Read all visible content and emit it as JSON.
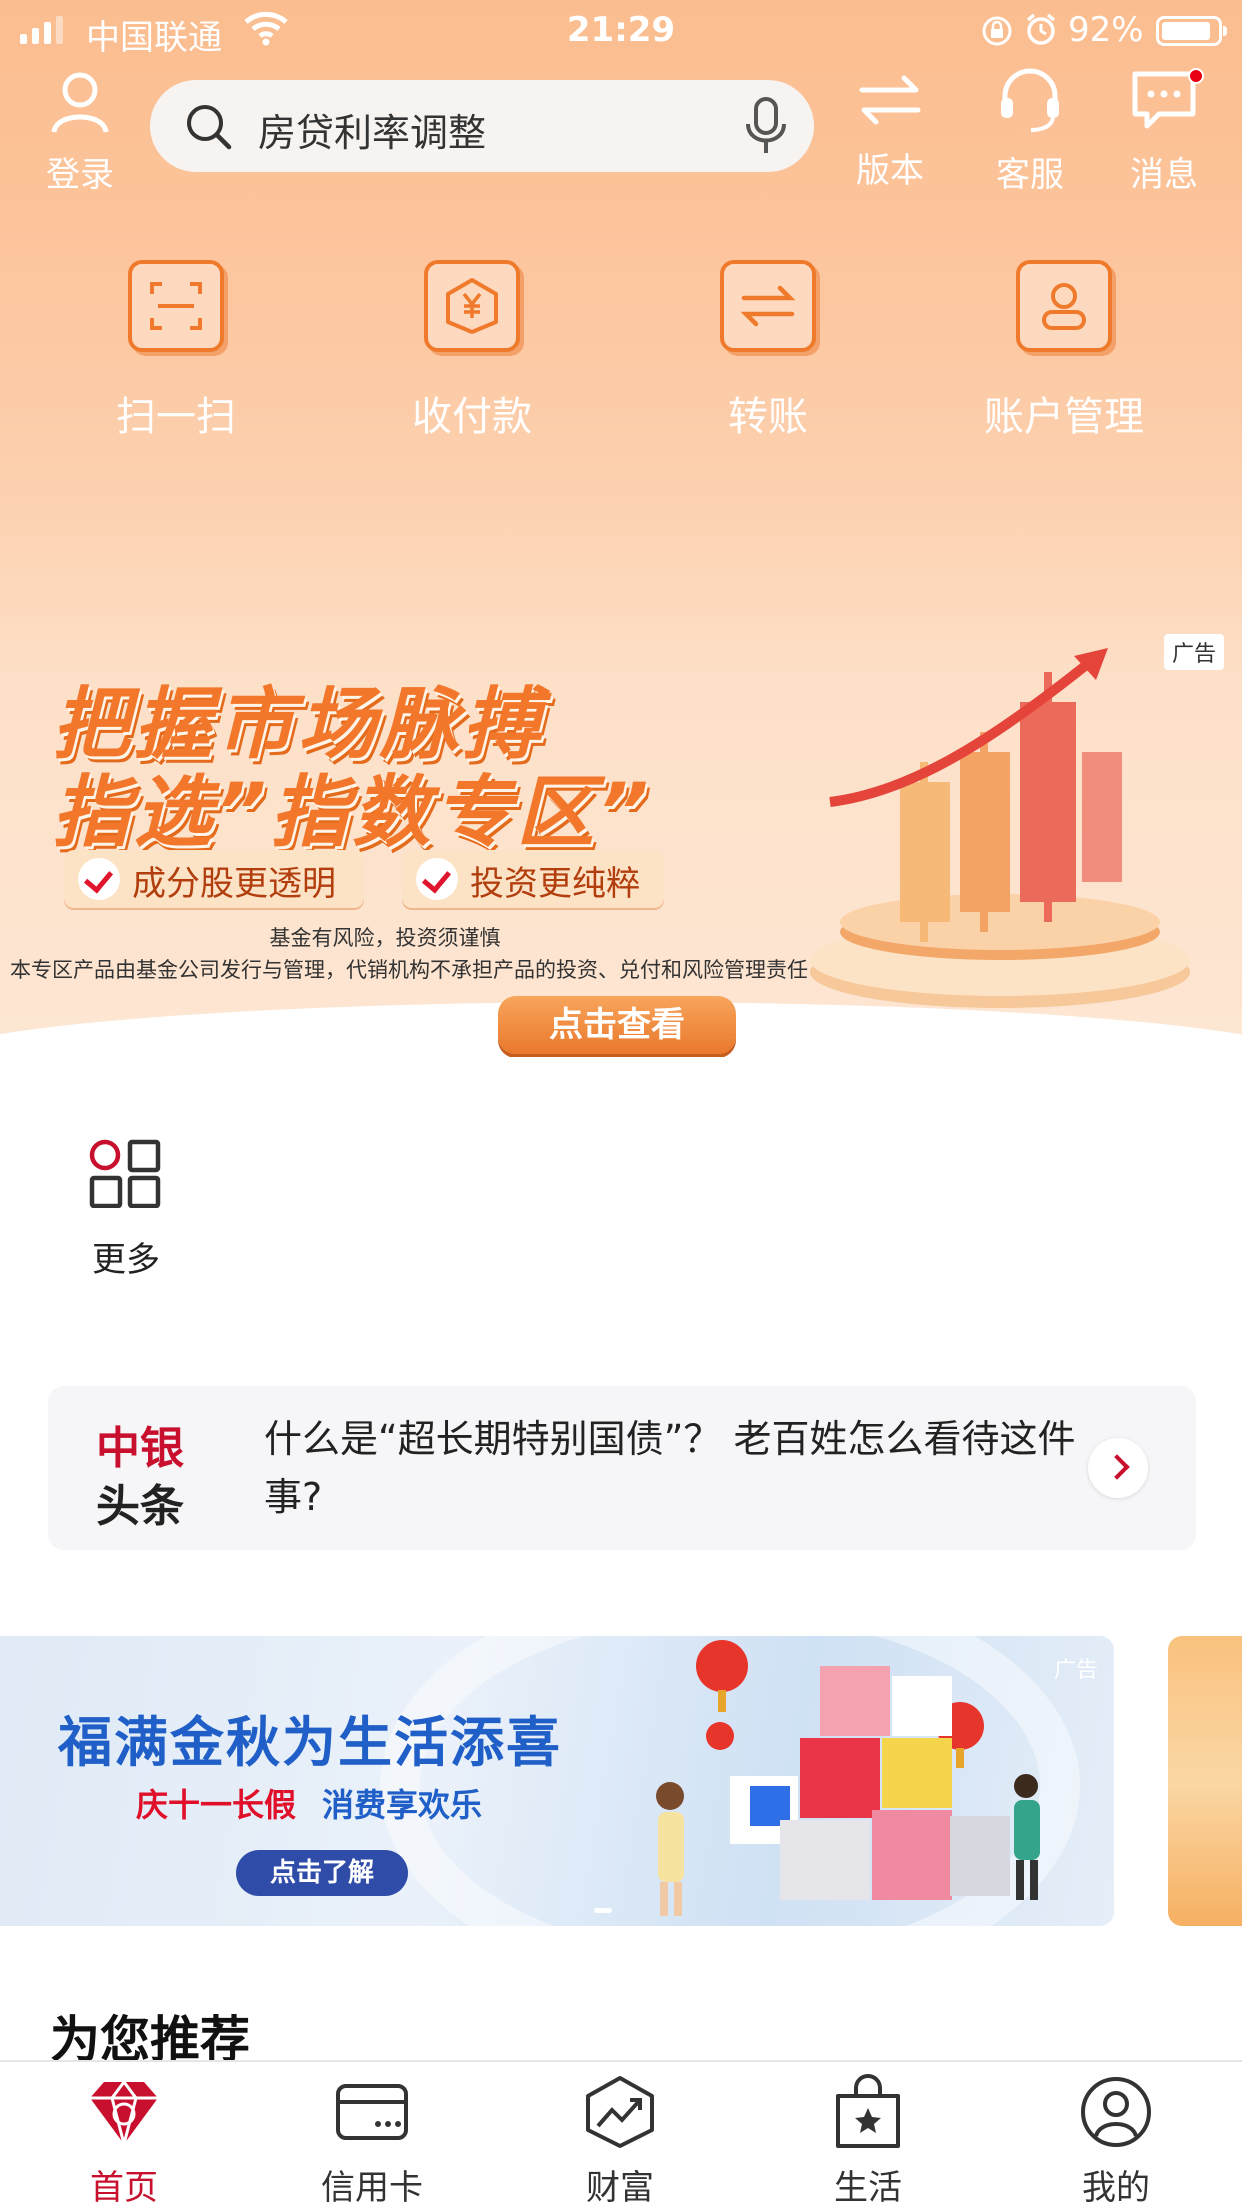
{
  "status_bar": {
    "carrier": "中国联通",
    "time": "21:29",
    "battery": "92%"
  },
  "header": {
    "login_label": "登录",
    "search_placeholder": "房贷利率调整",
    "version_label": "版本",
    "service_label": "客服",
    "message_label": "消息"
  },
  "quick_actions": [
    {
      "label": "扫一扫",
      "icon": "scan-icon"
    },
    {
      "label": "收付款",
      "icon": "yuan-payment-icon"
    },
    {
      "label": "转账",
      "icon": "transfer-icon"
    },
    {
      "label": "账户管理",
      "icon": "account-icon"
    }
  ],
  "promo": {
    "ad_label": "广告",
    "headline1": "把握市场脉搏",
    "headline2": "指选”指数专区”",
    "tag1": "成分股更透明",
    "tag2": "投资更纯粹",
    "risk_note1": "基金有风险，投资须谨慎",
    "risk_note2": "本专区产品由基金公司发行与管理，代销机构不承担产品的投资、兑付和风险管理责任",
    "cta": "点击查看"
  },
  "more": {
    "label": "更多"
  },
  "news": {
    "brand_line1": "中银",
    "brand_line2": "头条",
    "text": "什么是“超长期特别国债”？ 老百姓怎么看待这件事?"
  },
  "banner2": {
    "ad_label": "广告",
    "title": "福满金秋为生活添喜",
    "subtitle_red": "庆十一长假",
    "subtitle_blue": "消费享欢乐",
    "button": "点击了解"
  },
  "recommend": {
    "title": "为您推荐"
  },
  "tabbar": [
    {
      "label": "首页",
      "icon": "diamond-home-icon",
      "active": true
    },
    {
      "label": "信用卡",
      "icon": "credit-card-icon",
      "active": false
    },
    {
      "label": "财富",
      "icon": "wealth-chart-icon",
      "active": false
    },
    {
      "label": "生活",
      "icon": "shopping-bag-icon",
      "active": false
    },
    {
      "label": "我的",
      "icon": "user-profile-icon",
      "active": false
    }
  ],
  "colors": {
    "brand_red": "#c8102e",
    "header_orange": "#fbbd8f",
    "accent_orange": "#f07a2c",
    "banner_blue": "#1f5fc7"
  }
}
